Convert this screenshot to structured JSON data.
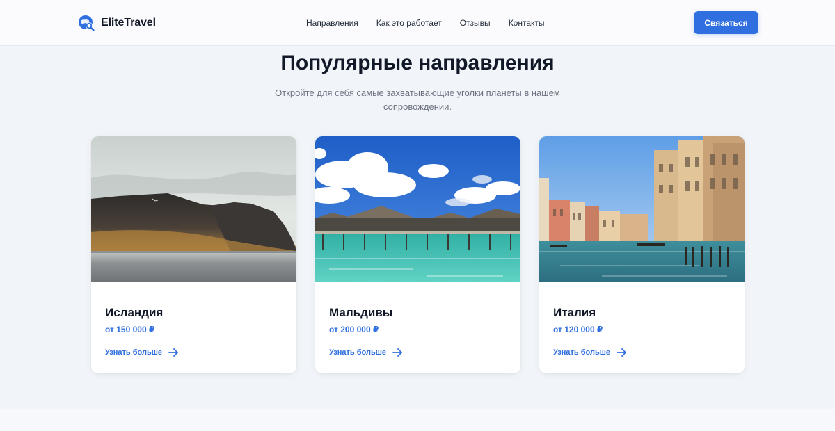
{
  "brand": {
    "name": "EliteTravel",
    "logo_icon": "globe-search-icon",
    "accent": "#2f6fe0"
  },
  "nav": {
    "items": [
      {
        "label": "Направления"
      },
      {
        "label": "Как это работает"
      },
      {
        "label": "Отзывы"
      },
      {
        "label": "Контакты"
      }
    ]
  },
  "header": {
    "cta_label": "Связаться"
  },
  "section": {
    "title": "Популярные направления",
    "subtitle": "Откройте для себя самые захватывающие уголки планеты в нашем сопровождении."
  },
  "cards": [
    {
      "title": "Исландия",
      "price": "от 150 000 ₽",
      "link_label": "Узнать больше",
      "image": "iceland-mountain-lake-photo",
      "link_icon": "arrow-right-icon"
    },
    {
      "title": "Мальдивы",
      "price": "от 200 000 ₽",
      "link_label": "Узнать больше",
      "image": "maldives-water-villas-photo",
      "link_icon": "arrow-right-icon"
    },
    {
      "title": "Италия",
      "price": "от 120 000 ₽",
      "link_label": "Узнать больше",
      "image": "venice-grand-canal-photo",
      "link_icon": "arrow-right-icon"
    }
  ]
}
